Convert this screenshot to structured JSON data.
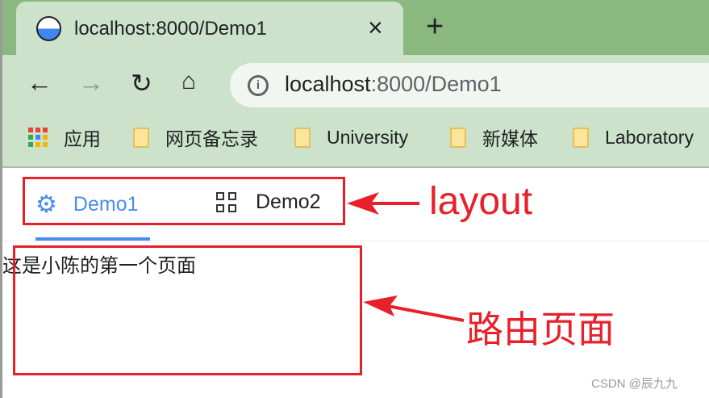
{
  "browser": {
    "tab_title": "localhost:8000/Demo1",
    "new_tab": "+",
    "close": "×",
    "url_host": "localhost",
    "url_rest": ":8000/Demo1",
    "bookmarks": [
      {
        "label": "应用"
      },
      {
        "label": "网页备忘录"
      },
      {
        "label": "University"
      },
      {
        "label": "新媒体"
      },
      {
        "label": "Laboratory"
      }
    ]
  },
  "page": {
    "nav": [
      {
        "label": "Demo1",
        "icon": "gear-icon",
        "active": true
      },
      {
        "label": "Demo2",
        "icon": "grid-icon",
        "active": false
      }
    ],
    "content": "这是小陈的第一个页面"
  },
  "annotations": {
    "layout": "layout",
    "router": "路由页面",
    "color": "#e8202a"
  },
  "watermark": "CSDN @辰九九"
}
